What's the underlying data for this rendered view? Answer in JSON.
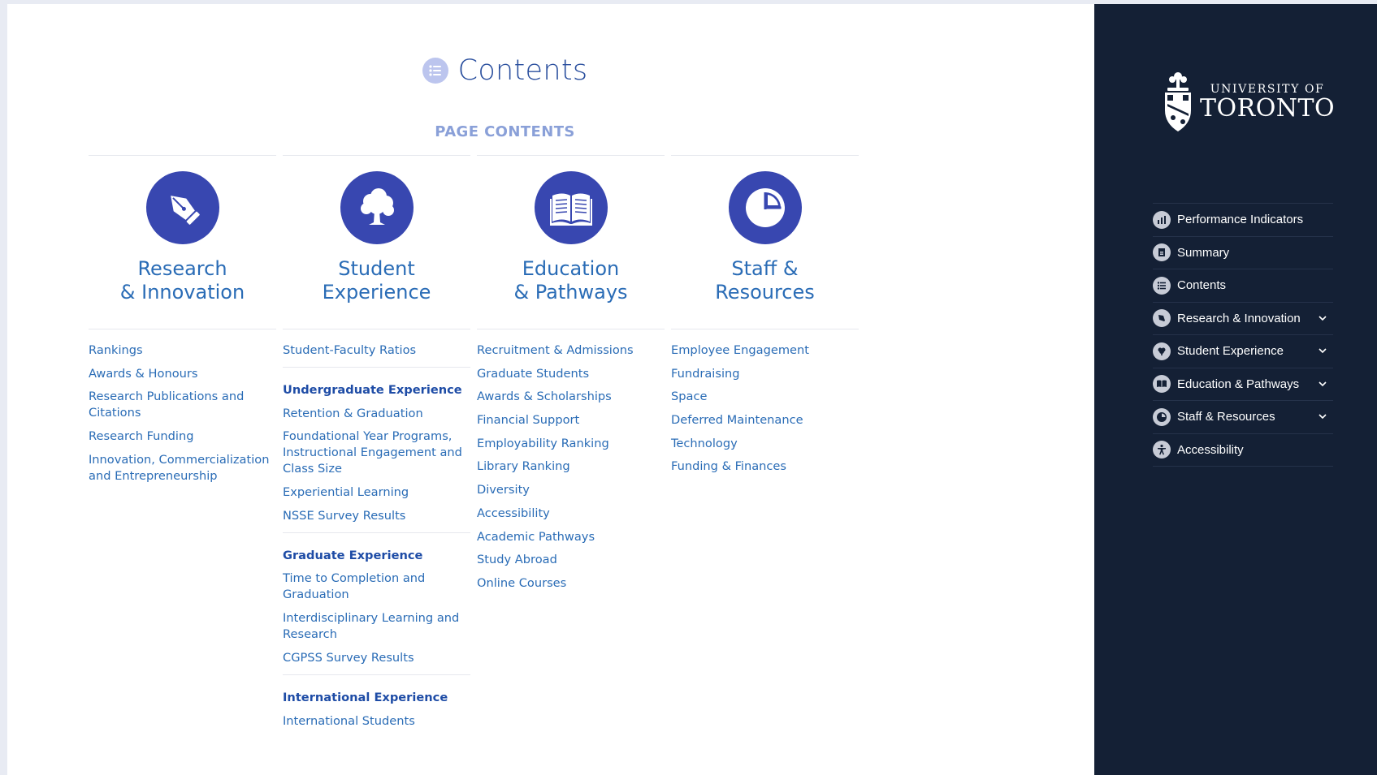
{
  "page": {
    "title": "Contents",
    "section_label": "PAGE CONTENTS"
  },
  "columns": [
    {
      "icon": "fountain-pen-icon",
      "heading_line1": "Research",
      "heading_line2": "& Innovation",
      "links": [
        "Rankings",
        "Awards & Honours",
        "Research Publications and Citations",
        "Research Funding",
        "Innovation, Commercialization and Entrepreneurship"
      ]
    },
    {
      "icon": "tree-icon",
      "heading_line1": "Student",
      "heading_line2": "Experience",
      "links": [
        "Student-Faculty Ratios"
      ],
      "undergrad_head": "Undergraduate Experience",
      "undergrad_links": [
        "Retention & Graduation",
        "Foundational Year Programs, Instructional Engagement and Class Size",
        "Experiential Learning",
        "NSSE Survey Results"
      ],
      "grad_head": "Graduate Experience",
      "grad_links": [
        "Time to Completion and Graduation",
        "Interdisciplinary Learning and Research",
        "CGPSS Survey Results"
      ],
      "intl_head": "International Experience",
      "intl_links": [
        "International Students"
      ]
    },
    {
      "icon": "open-book-icon",
      "heading_line1": "Education",
      "heading_line2": "& Pathways",
      "links": [
        "Recruitment & Admissions",
        "Graduate Students",
        "Awards & Scholarships",
        "Financial Support",
        "Employability Ranking",
        "Library Ranking",
        "Diversity",
        "Accessibility",
        "Academic Pathways",
        "Study Abroad",
        "Online Courses"
      ]
    },
    {
      "icon": "pie-chart-icon",
      "heading_line1": "Staff &",
      "heading_line2": "Resources",
      "links": [
        "Employee Engagement",
        "Fundraising",
        "Space",
        "Deferred Maintenance",
        "Technology",
        "Funding & Finances"
      ]
    }
  ],
  "sidebar": {
    "logo_small": "UNIVERSITY OF",
    "logo_big": "TORONTO",
    "nav": [
      {
        "label": "Performance Indicators",
        "icon": "bar-chart-icon",
        "expandable": false
      },
      {
        "label": "Summary",
        "icon": "document-icon",
        "expandable": false
      },
      {
        "label": "Contents",
        "icon": "list-icon",
        "expandable": false
      },
      {
        "label": "Research & Innovation",
        "icon": "fountain-pen-icon",
        "expandable": true
      },
      {
        "label": "Student Experience",
        "icon": "tree-icon",
        "expandable": true
      },
      {
        "label": "Education & Pathways",
        "icon": "open-book-icon",
        "expandable": true
      },
      {
        "label": "Staff & Resources",
        "icon": "pie-chart-icon",
        "expandable": true
      },
      {
        "label": "Accessibility",
        "icon": "accessibility-icon",
        "expandable": false
      }
    ]
  },
  "colors": {
    "accent": "#3847b0",
    "link": "#2a6cb6",
    "sidebar_bg": "#142035"
  }
}
